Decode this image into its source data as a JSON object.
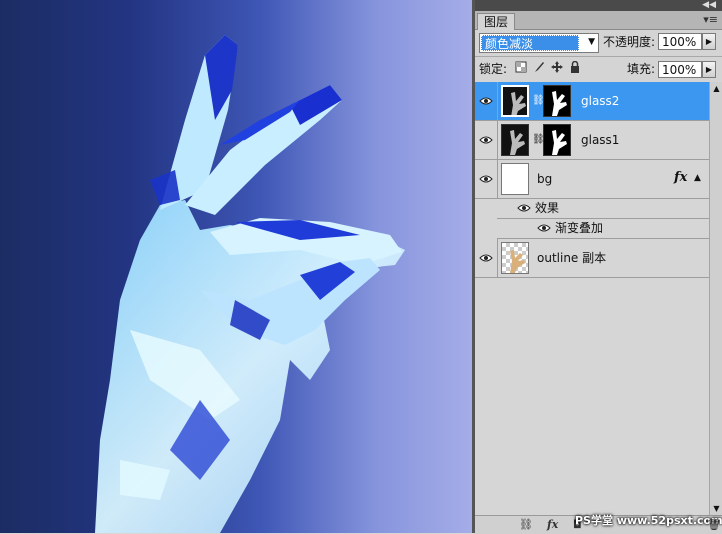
{
  "canvas": {
    "description_icon": "glass-hand-artwork"
  },
  "panel": {
    "tab_label": "图层",
    "collapse_glyph": "◀◀",
    "menu_glyph": "▾≡",
    "blend_mode": "颜色减淡",
    "opacity_label": "不透明度:",
    "opacity_value": "100%",
    "lock_label": "锁定:",
    "fill_label": "填充:",
    "fill_value": "100%"
  },
  "layers": [
    {
      "name": "glass2",
      "active": true
    },
    {
      "name": "glass1",
      "active": false
    },
    {
      "name": "bg",
      "active": false,
      "fx": "fx"
    },
    {
      "name": "outline 副本",
      "active": false
    }
  ],
  "effects": {
    "header": "效果",
    "item": "渐变叠加"
  },
  "watermark": "PS学堂 www.52psxt.com",
  "colors": {
    "accent": "#3b97f0",
    "canvas_dark": "#1c2c63",
    "canvas_light": "#a5ade8"
  }
}
